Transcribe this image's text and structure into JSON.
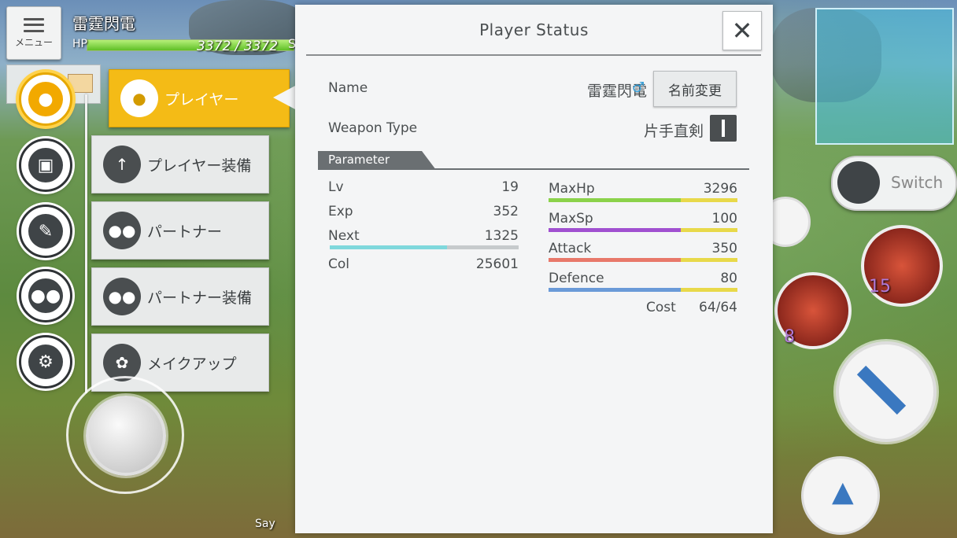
{
  "hud": {
    "menu_label": "メニュー",
    "player_name": "雷霆閃電",
    "hp_label": "HP",
    "hp_value": "3372 / 3372",
    "hp_fraction": 1.0,
    "sp_cut_label": "S",
    "say_label": "Say"
  },
  "side_menu": {
    "items": [
      {
        "label": "プレイヤー",
        "active": true
      },
      {
        "label": "プレイヤー装備",
        "active": false
      },
      {
        "label": "パートナー",
        "active": false
      },
      {
        "label": "パートナー装備",
        "active": false
      },
      {
        "label": "メイクアップ",
        "active": false
      }
    ]
  },
  "dialog": {
    "title": "Player Status",
    "close_symbol": "✕",
    "name_label": "Name",
    "name_value": "雷霆閃電",
    "gender_symbol": "♂",
    "rename_button": "名前変更",
    "weapon_label": "Weapon Type",
    "weapon_value": "片手直剣",
    "parameter_tab": "Parameter",
    "left_stats": [
      {
        "label": "Lv",
        "value": "19"
      },
      {
        "label": "Exp",
        "value": "352"
      },
      {
        "label": "Next",
        "value": "1325"
      },
      {
        "label": "Col",
        "value": "25601"
      }
    ],
    "next_progress": 0.62,
    "right_stats": [
      {
        "label": "MaxHp",
        "value": "3296",
        "color": "#8bd24a",
        "fraction": 0.7
      },
      {
        "label": "MaxSp",
        "value": "100",
        "color": "#a050d0",
        "fraction": 0.7
      },
      {
        "label": "Attack",
        "value": "350",
        "color": "#e8786a",
        "fraction": 0.7
      },
      {
        "label": "Defence",
        "value": "80",
        "color": "#6a9ad8",
        "fraction": 0.7
      }
    ],
    "cost_label": "Cost",
    "cost_value": "64/64"
  },
  "right_hud": {
    "switch_label": "Switch",
    "skill_counts": [
      "15",
      "8"
    ]
  },
  "colors": {
    "accent_yellow": "#f4bb16",
    "panel_bg": "#f4f5f6",
    "text_dark": "#4a4e50"
  }
}
